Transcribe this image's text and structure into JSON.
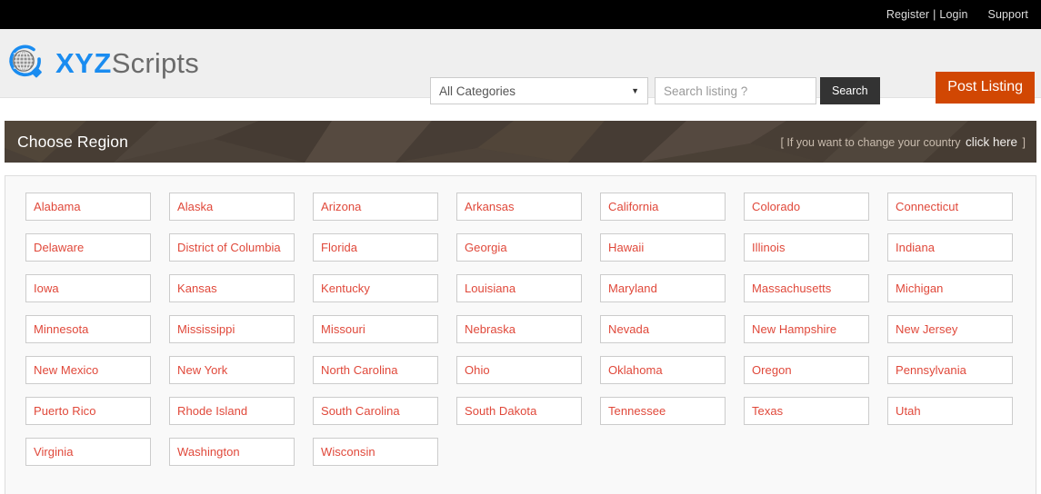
{
  "topbar": {
    "register_label": "Register",
    "separator": "|",
    "login_label": "Login",
    "support_label": "Support"
  },
  "masthead": {
    "brand_primary": "XYZ",
    "brand_secondary": "Scripts",
    "logo_icon": "globe-magnifier-icon",
    "search": {
      "category_selected": "All Categories",
      "category_caret_icon": "chevron-down-icon",
      "input_value": "",
      "input_placeholder": "Search listing ?",
      "button_label": "Search"
    },
    "post_listing_label": "Post Listing"
  },
  "banner": {
    "title": "Choose Region",
    "note_prefix": "[ If you want to change your country",
    "note_link": "click here",
    "note_suffix": "]"
  },
  "colors": {
    "accent_orange": "#d14703",
    "brand_blue": "#1a8cf0",
    "brand_gray": "#6b6b6b",
    "state_link_red": "#e0483a",
    "banner_brown": "#4c4239",
    "search_button_dark": "#333333",
    "topbar_black": "#000000"
  },
  "regions": {
    "columns": 7,
    "items": [
      "Alabama",
      "Alaska",
      "Arizona",
      "Arkansas",
      "California",
      "Colorado",
      "Connecticut",
      "Delaware",
      "District of Columbia",
      "Florida",
      "Georgia",
      "Hawaii",
      "Illinois",
      "Indiana",
      "Iowa",
      "Kansas",
      "Kentucky",
      "Louisiana",
      "Maryland",
      "Massachusetts",
      "Michigan",
      "Minnesota",
      "Mississippi",
      "Missouri",
      "Nebraska",
      "Nevada",
      "New Hampshire",
      "New Jersey",
      "New Mexico",
      "New York",
      "North Carolina",
      "Ohio",
      "Oklahoma",
      "Oregon",
      "Pennsylvania",
      "Puerto Rico",
      "Rhode Island",
      "South Carolina",
      "South Dakota",
      "Tennessee",
      "Texas",
      "Utah",
      "Virginia",
      "Washington",
      "Wisconsin"
    ]
  }
}
